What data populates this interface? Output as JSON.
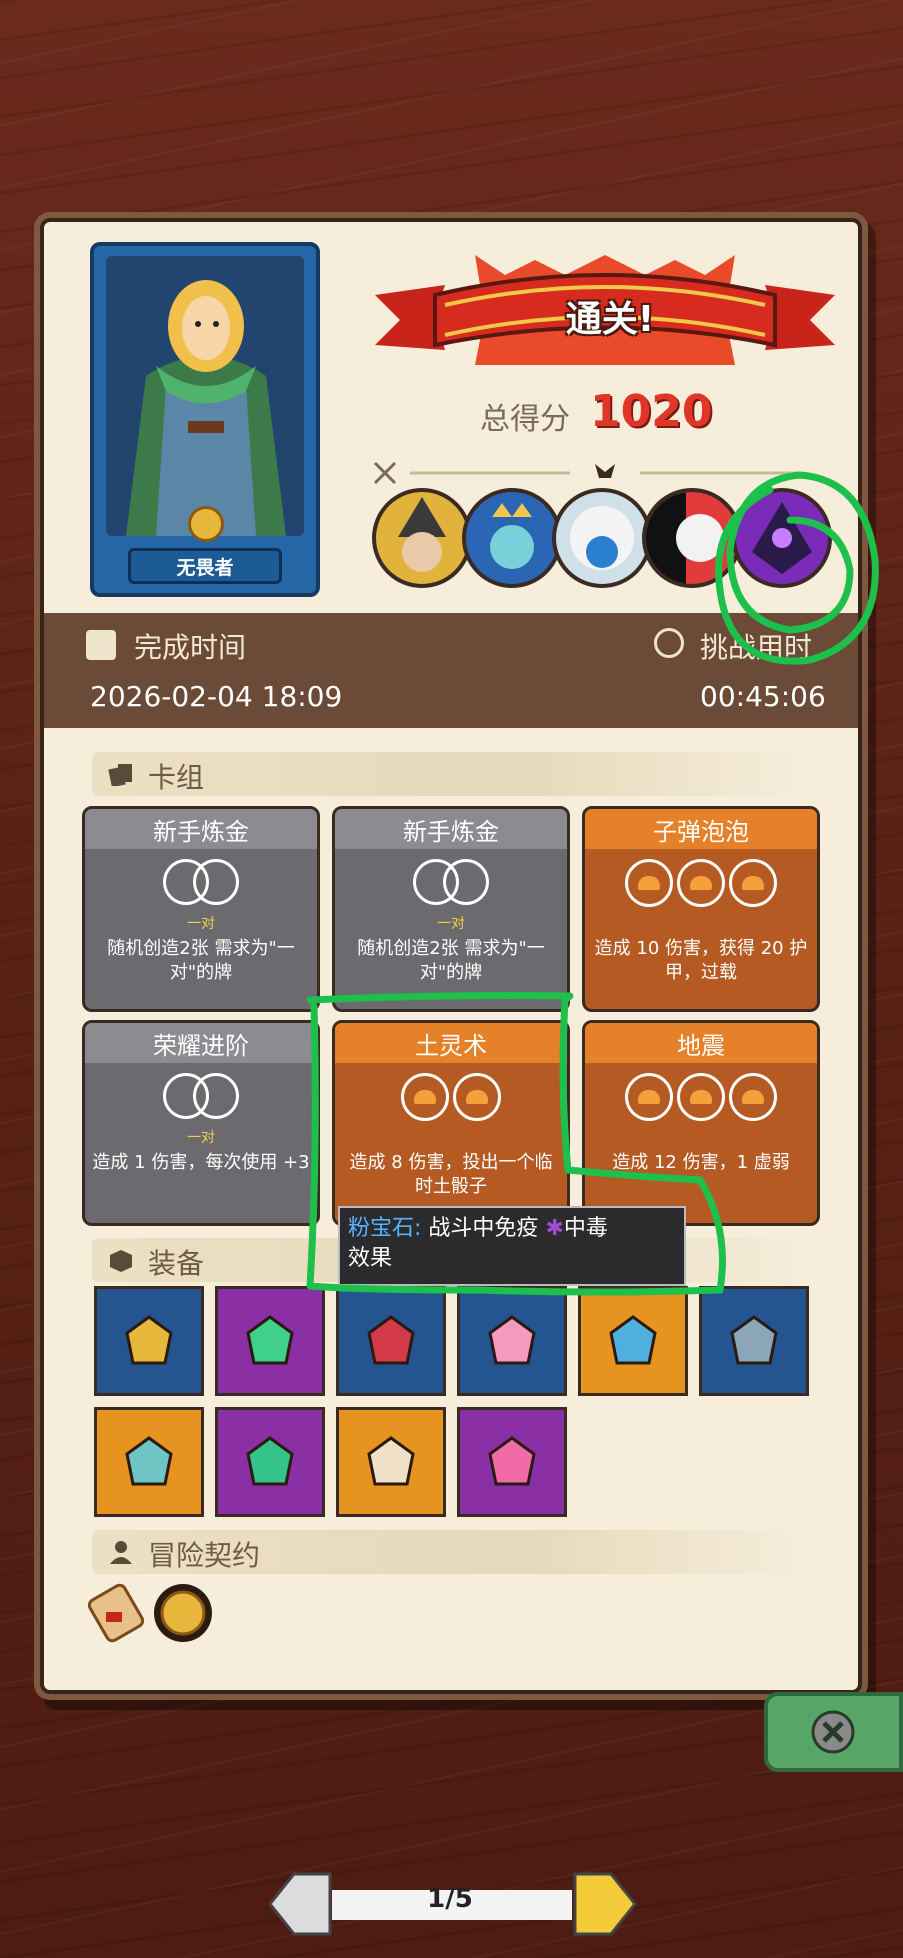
{
  "hero": {
    "title": "无畏者"
  },
  "result": {
    "banner": "通关!",
    "score_label": "总得分",
    "score_value": "1020"
  },
  "completion": {
    "time_label": "完成时间",
    "date_value": "2026-02-04 18:09",
    "challenge_label": "挑战用时",
    "challenge_value": "00:45:06"
  },
  "deck": {
    "title": "卡组",
    "cards": [
      {
        "name": "新手炼金",
        "color": "gray",
        "sub": "一对",
        "desc": "随机创造2张 需求为\"一对\"的牌"
      },
      {
        "name": "新手炼金",
        "color": "gray",
        "sub": "一对",
        "desc": "随机创造2张 需求为\"一对\"的牌"
      },
      {
        "name": "子弹泡泡",
        "color": "orange",
        "sub": "",
        "desc": "造成 10 伤害，获得 20 护甲，过载"
      },
      {
        "name": "荣耀进阶",
        "color": "gray",
        "sub": "一对",
        "desc": "造成 1 伤害，每次使用 +3"
      },
      {
        "name": "土灵术",
        "color": "orange",
        "sub": "",
        "desc": "造成 8 伤害，投出一个临时土骰子"
      },
      {
        "name": "地震",
        "color": "orange",
        "sub": "",
        "desc": "造成 12 伤害，1 虚弱"
      }
    ]
  },
  "tooltip": {
    "key": "粉宝石:",
    "text1": "战斗中免疫",
    "status": "中毒",
    "text2": "效果"
  },
  "equipment": {
    "title": "装备",
    "items": [
      {
        "icon": "gold-ring-icon",
        "bg": "blue"
      },
      {
        "icon": "green-gem-amulet-icon",
        "bg": "purple"
      },
      {
        "icon": "ruby-scepter-icon",
        "bg": "blue"
      },
      {
        "icon": "pink-gem-icon",
        "bg": "blue"
      },
      {
        "icon": "slime-creature-icon",
        "bg": "orange"
      },
      {
        "icon": "scythe-blade-icon",
        "bg": "blue"
      },
      {
        "icon": "teal-vase-icon",
        "bg": "orange"
      },
      {
        "icon": "emerald-crystal-icon",
        "bg": "purple"
      },
      {
        "icon": "target-charm-icon",
        "bg": "orange"
      },
      {
        "icon": "heart-necklace-icon",
        "bg": "purple"
      }
    ]
  },
  "contract": {
    "title": "冒险契约",
    "items": [
      "scroll-icon",
      "gold-coin-icon"
    ]
  },
  "pager": {
    "text": "1/5"
  },
  "colors": {
    "panel": "#f6eedb",
    "score": "#e0362a",
    "annotation": "#1cc04a"
  }
}
